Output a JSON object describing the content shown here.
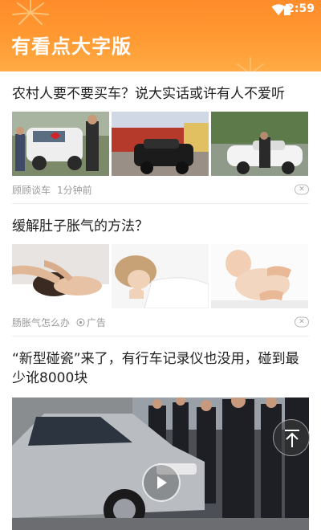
{
  "status_bar": {
    "time": "2:59"
  },
  "app": {
    "title": "有看点大字版"
  },
  "articles": [
    {
      "title": "农村人要不要买车？说大实话或许有人不爱听",
      "source": "顾顾谈车",
      "time": "1分钟前",
      "images": [
        "white-minivan-with-red-ribbon-photo",
        "black-suv-in-village-photo",
        "white-sedan-with-driver-photo"
      ]
    },
    {
      "title": "缓解肚子胀气的方法？",
      "source": "肠胀气怎么办",
      "ad_label": "广告",
      "images": [
        "head-massage-photo",
        "sleeping-woman-photo",
        "baby-belly-massage-photo"
      ]
    },
    {
      "title": "“新型碰瓷”来了，有行车记录仪也没用，碰到最少讹8000块",
      "image": "silver-car-crowd-video-thumbnail"
    }
  ],
  "icons": {
    "dismiss": "×",
    "play": "play-icon",
    "back_to_top": "arrow-up-icon",
    "ad": "ad-target-icon"
  },
  "colors": {
    "header": "#ff9a33",
    "title_text": "#ffffff"
  }
}
